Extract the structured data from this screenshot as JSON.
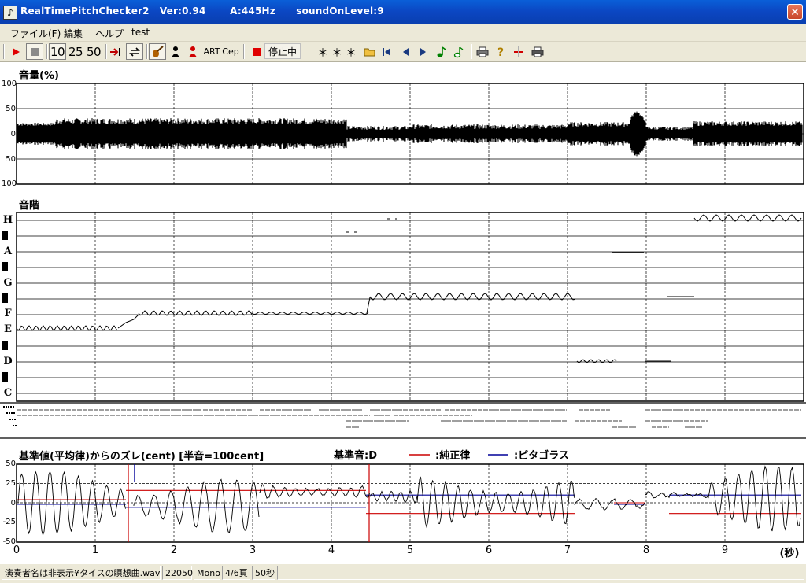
{
  "window": {
    "title": "RealTimePitchChecker2   Ver:0.94       A:445Hz      soundOnLevel:9",
    "close_glyph": "✕"
  },
  "menu": [
    "ファイル(F)",
    "編集",
    "ヘルプ",
    "test"
  ],
  "toolbar": {
    "zoom_options": [
      "10",
      "25",
      "50"
    ],
    "text_buttons": [
      "ART",
      "Cep"
    ],
    "status_label": "停止中",
    "stars": "＊＊＊"
  },
  "volume_panel": {
    "title": "音量(%)",
    "y_ticks": [
      "100",
      "50",
      "0",
      "50",
      "100"
    ]
  },
  "scale_panel": {
    "title": "音階",
    "notes": [
      "H",
      "A",
      "G",
      "F",
      "E",
      "D",
      "C"
    ]
  },
  "deviation_panel": {
    "title": "基準値(平均律)からのズレ(cent) [半音=100cent]",
    "reference_label": "基準音:D",
    "legend": [
      {
        "label": ":純正律",
        "color": "#cc0000"
      },
      {
        "label": ":ピタゴラス",
        "color": "#000099"
      }
    ],
    "y_ticks": [
      "50",
      "25",
      "0",
      "-25",
      "-50"
    ],
    "x_ticks": [
      "0",
      "1",
      "2",
      "3",
      "4",
      "5",
      "6",
      "7",
      "8",
      "9"
    ],
    "x_unit": "(秒)"
  },
  "status_bar": {
    "file": "演奏者名は非表示¥タイスの瞑想曲.wav",
    "sample_rate": "22050",
    "channels": "Mono",
    "page": "4/6頁",
    "duration": "50秒"
  },
  "colors": {
    "title_bar": "#0b4fd0",
    "chrome": "#ece9d8",
    "just_intonation": "#cc0000",
    "pythagorean": "#000099"
  }
}
